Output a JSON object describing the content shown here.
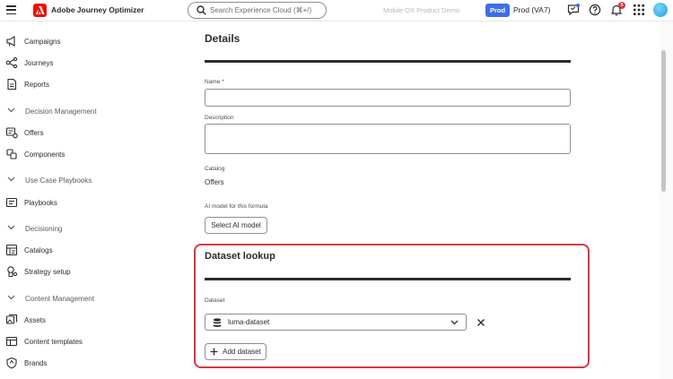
{
  "app": {
    "title": "Adobe Journey Optimizer",
    "org": "Mobile OX Product Demo",
    "env_badge": "Prod",
    "sandbox": "Prod (VA7)",
    "notification_count": "5"
  },
  "search": {
    "placeholder": "Search Experience Cloud (⌘+/)"
  },
  "sidebar": {
    "items": [
      {
        "label": "Campaigns",
        "icon": "campaigns-icon"
      },
      {
        "label": "Journeys",
        "icon": "journeys-icon"
      },
      {
        "label": "Reports",
        "icon": "reports-icon"
      },
      {
        "label": "Decision Management",
        "group": true
      },
      {
        "label": "Offers",
        "icon": "offers-icon"
      },
      {
        "label": "Components",
        "icon": "components-icon"
      },
      {
        "label": "Use Case Playbooks",
        "group": true
      },
      {
        "label": "Playbooks",
        "icon": "playbooks-icon"
      },
      {
        "label": "Decisioning",
        "group": true
      },
      {
        "label": "Catalogs",
        "icon": "catalogs-icon"
      },
      {
        "label": "Strategy setup",
        "icon": "strategy-icon"
      },
      {
        "label": "Content Management",
        "group": true
      },
      {
        "label": "Assets",
        "icon": "assets-icon"
      },
      {
        "label": "Content templates",
        "icon": "content-templates-icon"
      },
      {
        "label": "Brands",
        "icon": "brands-icon"
      }
    ]
  },
  "details": {
    "heading": "Details",
    "name_label": "Name",
    "name_required": "*",
    "name_value": "",
    "description_label": "Description",
    "description_value": "",
    "catalog_label": "Catalog",
    "catalog_value": "Offers",
    "ai_model_label": "AI model for this formula",
    "ai_model_button": "Select AI model"
  },
  "dataset_lookup": {
    "heading": "Dataset lookup",
    "dataset_label": "Dataset",
    "dataset_value": "luma-dataset",
    "add_button": "Add dataset"
  },
  "colors": {
    "accent": "#3d6ee6",
    "brand": "#eb1000",
    "highlight": "#d7373f"
  }
}
